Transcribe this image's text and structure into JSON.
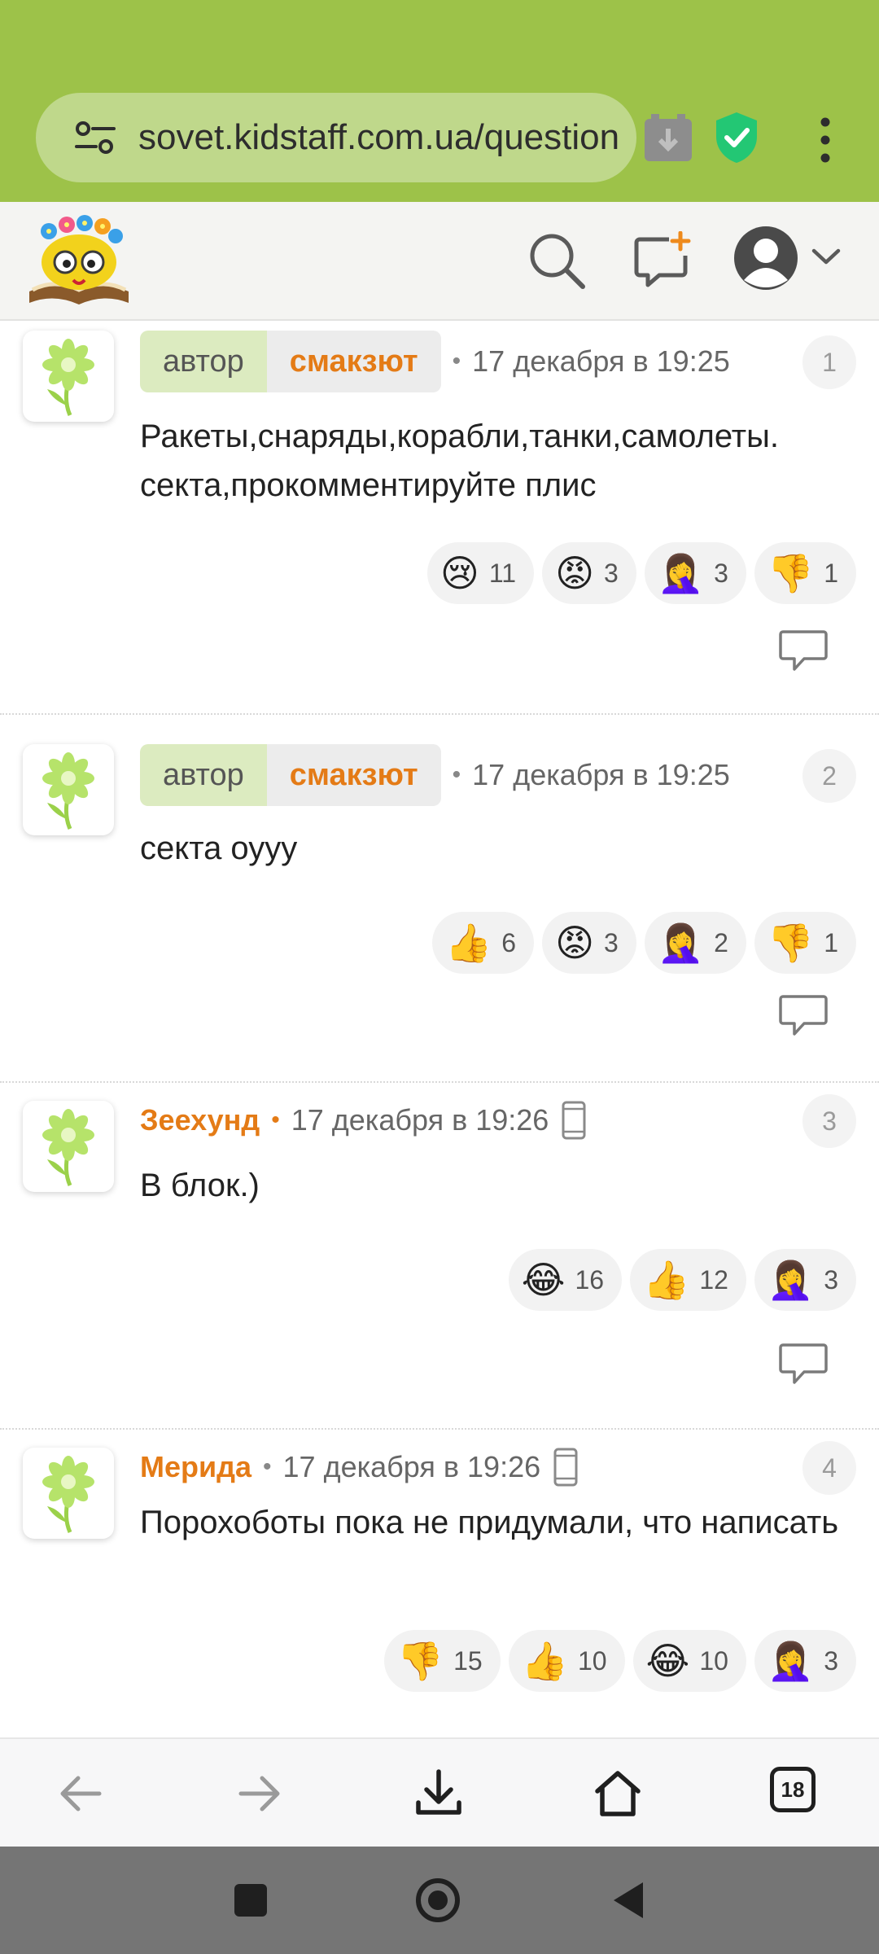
{
  "browser": {
    "url": "sovet.kidstaff.com.ua/question",
    "tabs_count": "18",
    "colors": {
      "toolbar": "#9dc249",
      "url_bar": "#bfd88b"
    }
  },
  "site": {
    "icons": [
      "search-icon",
      "new-post-icon",
      "user-avatar-icon",
      "chevron-down-icon"
    ]
  },
  "comments": [
    {
      "number": "1",
      "role": "автор",
      "username": "смакзют",
      "date": "17 декабря в 19:25",
      "mobile": false,
      "text": "Ракеты,снаряды,корабли,танки,самолеты. секта,прокомментируйте плис",
      "reactions": [
        {
          "emoji": "😢",
          "count": "11",
          "icon": "crying-face"
        },
        {
          "emoji": "😡",
          "count": "3",
          "icon": "angry-face"
        },
        {
          "emoji": "🤦‍♀️",
          "count": "3",
          "icon": "facepalm"
        },
        {
          "emoji": "👎",
          "count": "1",
          "icon": "thumbs-down"
        }
      ]
    },
    {
      "number": "2",
      "role": "автор",
      "username": "смакзют",
      "date": "17 декабря в 19:25",
      "mobile": false,
      "text": "секта оууу",
      "reactions": [
        {
          "emoji": "👍",
          "count": "6",
          "icon": "thumbs-up"
        },
        {
          "emoji": "😡",
          "count": "3",
          "icon": "angry-face"
        },
        {
          "emoji": "🤦‍♀️",
          "count": "2",
          "icon": "facepalm"
        },
        {
          "emoji": "👎",
          "count": "1",
          "icon": "thumbs-down"
        }
      ]
    },
    {
      "number": "3",
      "role": "",
      "username": "Зеехунд",
      "date": "17 декабря в 19:26",
      "mobile": true,
      "text": "В блок.)",
      "reactions": [
        {
          "emoji": "😂",
          "count": "16",
          "icon": "tears-of-joy"
        },
        {
          "emoji": "👍",
          "count": "12",
          "icon": "thumbs-up"
        },
        {
          "emoji": "🤦‍♀️",
          "count": "3",
          "icon": "facepalm"
        }
      ]
    },
    {
      "number": "4",
      "role": "",
      "username": "Мерида",
      "date": "17 декабря в 19:26",
      "mobile": true,
      "text": "Порохоботы пока не придумали, что написать",
      "reactions": [
        {
          "emoji": "👎",
          "count": "15",
          "icon": "thumbs-down"
        },
        {
          "emoji": "👍",
          "count": "10",
          "icon": "thumbs-up"
        },
        {
          "emoji": "😂",
          "count": "10",
          "icon": "tears-of-joy"
        },
        {
          "emoji": "🤦‍♀️",
          "count": "3",
          "icon": "facepalm"
        }
      ]
    }
  ]
}
